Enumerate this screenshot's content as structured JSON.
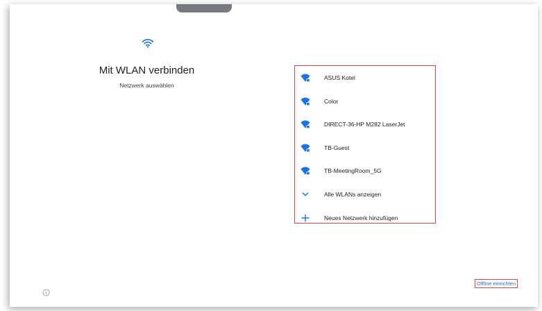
{
  "header": {
    "title": "Mit WLAN verbinden",
    "subtitle": "Netzwerk auswählen",
    "wifi_icon": "wifi-icon"
  },
  "networks": [
    {
      "name": "ASUS Kotel",
      "icon": "wifi-lock-icon"
    },
    {
      "name": "Color",
      "icon": "wifi-lock-icon"
    },
    {
      "name": "DIRECT-36-HP M282 LaserJet",
      "icon": "wifi-lock-icon"
    },
    {
      "name": "TB-Guest",
      "icon": "wifi-lock-icon"
    },
    {
      "name": "TB-MeetingRoom_5G",
      "icon": "wifi-lock-icon"
    }
  ],
  "actions": {
    "show_all": "Alle WLANs anzeigen",
    "add_network": "Neues Netzwerk hinzufügen",
    "offline_setup": "Offline einrichten"
  },
  "colors": {
    "accent": "#1a73e8",
    "highlight_border": "#e0424b"
  }
}
